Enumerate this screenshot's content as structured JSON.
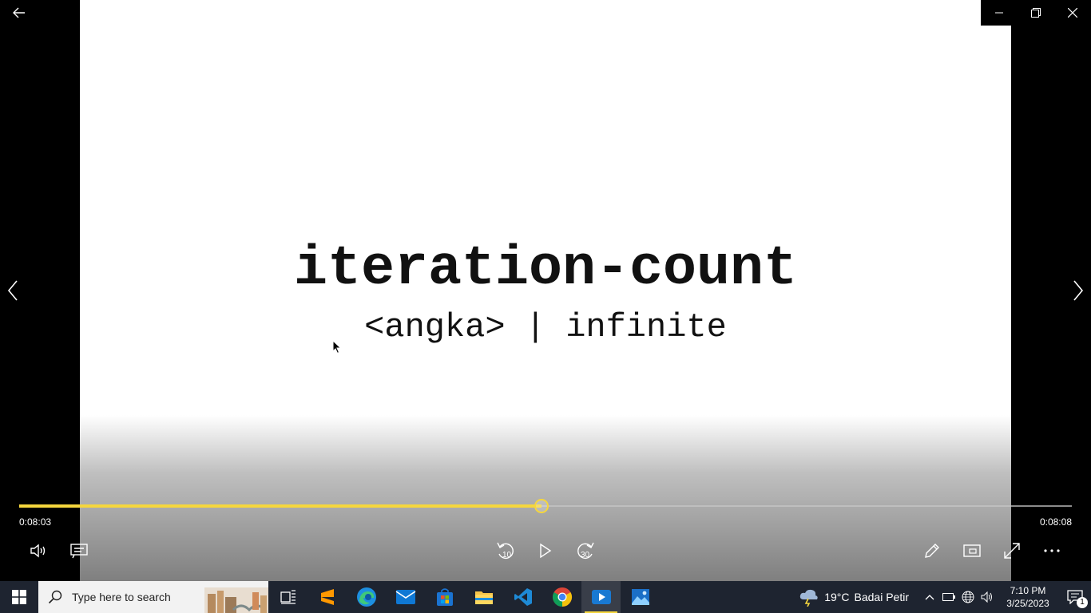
{
  "player": {
    "slide_title": "iteration-count",
    "slide_subtitle": "<angka> | infinite",
    "current_time": "0:08:03",
    "total_time": "0:08:08",
    "progress_fraction": 0.496,
    "accent_color": "#f5d63d",
    "skip_back_label": "10",
    "skip_forward_label": "30"
  },
  "icons": {
    "back": "arrow-left-icon",
    "minimize": "minimize-icon",
    "restore": "restore-icon",
    "close": "close-icon",
    "prev": "chevron-left-icon",
    "next": "chevron-right-icon",
    "volume": "volume-icon",
    "captions": "captions-icon",
    "play": "play-icon",
    "edit": "pencil-icon",
    "miniview": "mini-view-icon",
    "fullscreen": "fullscreen-icon",
    "more": "more-icon"
  },
  "taskbar": {
    "search_placeholder": "Type here to search",
    "weather_temp": "19°C",
    "weather_desc": "Badai Petir",
    "clock_time": "7:10 PM",
    "clock_date": "3/25/2023",
    "notification_count": "1",
    "apps": [
      "task-view",
      "sublime-text",
      "edge",
      "mail",
      "microsoft-store",
      "file-explorer",
      "vs-code",
      "chrome",
      "media-player",
      "photos"
    ]
  }
}
